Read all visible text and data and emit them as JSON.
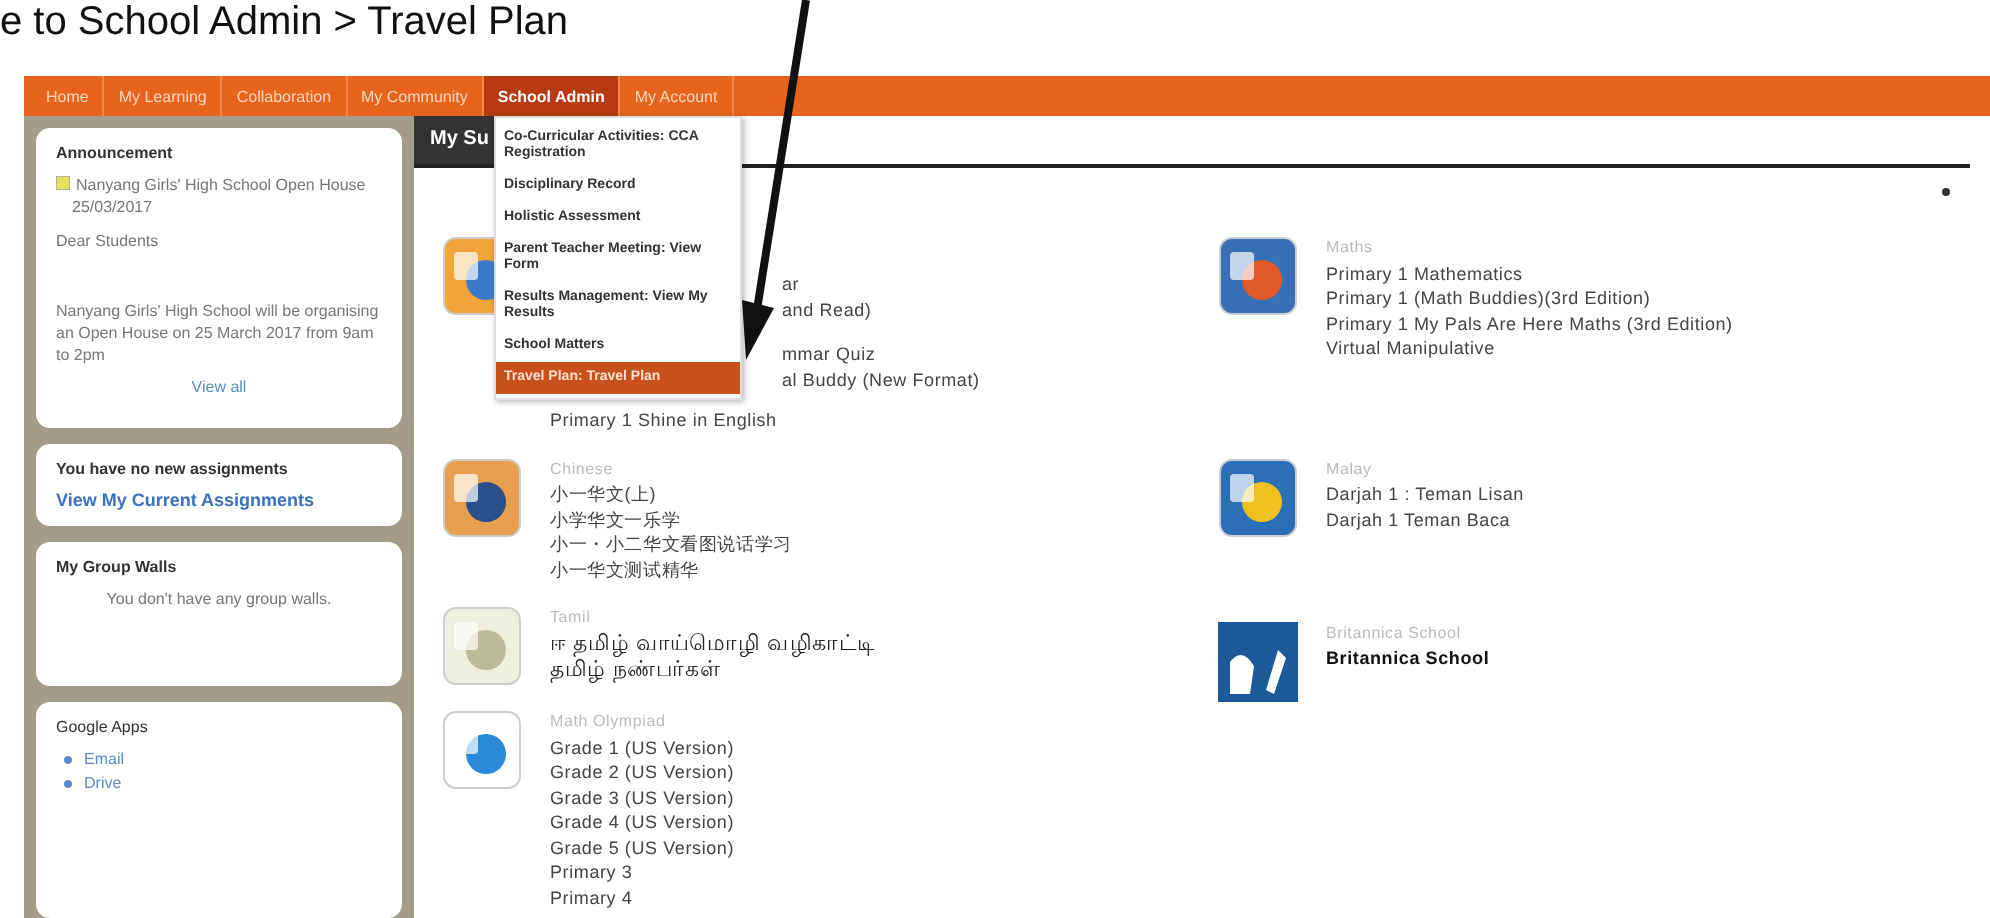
{
  "caption": "e to School Admin > Travel Plan",
  "nav": [
    {
      "label": "Home",
      "selected": false
    },
    {
      "label": "My Learning",
      "selected": false
    },
    {
      "label": "Collaboration",
      "selected": false
    },
    {
      "label": "My Community",
      "selected": false
    },
    {
      "label": "School Admin",
      "selected": true
    },
    {
      "label": "My Account",
      "selected": false
    }
  ],
  "menu": [
    {
      "label": "Co-Curricular Activities: CCA Registration",
      "selected": false
    },
    {
      "label": "Disciplinary Record",
      "selected": false
    },
    {
      "label": "Holistic Assessment",
      "selected": false
    },
    {
      "label": "Parent Teacher Meeting: View Form",
      "selected": false
    },
    {
      "label": "Results Management: View My Results",
      "selected": false
    },
    {
      "label": "School Matters",
      "selected": false
    },
    {
      "label": "Travel Plan: Travel Plan",
      "selected": true
    }
  ],
  "sidebar": {
    "announcement": {
      "title": "Announcement",
      "headline": "Nanyang Girls' High School Open House",
      "date": "25/03/2017",
      "greeting": "Dear Students",
      "body": "Nanyang Girls' High School will be organising an Open House on 25 March 2017 from 9am to 2pm",
      "link": "View all"
    },
    "assignments": {
      "title": "You have no new assignments",
      "link": "View My Current Assignments"
    },
    "group_walls": {
      "title": "My Group Walls",
      "message": "You don't have any group walls."
    },
    "google_apps": {
      "title": "Google Apps",
      "links": [
        "Email",
        "Drive"
      ]
    }
  },
  "main": {
    "tab": "My Su",
    "columns": [
      [
        {
          "lines": [
            "ar",
            "and Read)",
            "mmar Quiz",
            "al Buddy (New Format)",
            "Primary 1 Shine in English"
          ]
        },
        {
          "heading": "Chinese",
          "lines": [
            "小一华文(上)",
            "小学华文一乐学",
            "小一・小二华文看图说话学习",
            "小一华文测试精华"
          ]
        },
        {
          "heading": "Tamil",
          "lines": [
            "ஈ தமிழ் வாய்மொழி வழிகாட்டி",
            "தமிழ் நண்பர்கள்"
          ]
        },
        {
          "heading": "Math Olympiad",
          "lines": [
            "Grade 1 (US Version)",
            "Grade 2 (US Version)",
            "Grade 3 (US Version)",
            "Grade 4 (US Version)",
            "Grade 5 (US Version)",
            "Primary 3",
            "Primary 4"
          ]
        }
      ],
      [
        {
          "heading": "Maths",
          "lines": [
            "Primary 1 Mathematics",
            "Primary 1 (Math Buddies)(3rd Edition)",
            "Primary 1 My Pals Are Here Maths (3rd Edition)",
            "Virtual Manipulative"
          ]
        },
        {
          "heading": "Malay",
          "lines": [
            "Darjah 1 : Teman Lisan",
            "Darjah 1 Teman Baca"
          ]
        },
        {
          "heading": "Britannica School",
          "lines": [
            "Britannica School"
          ]
        }
      ]
    ]
  }
}
